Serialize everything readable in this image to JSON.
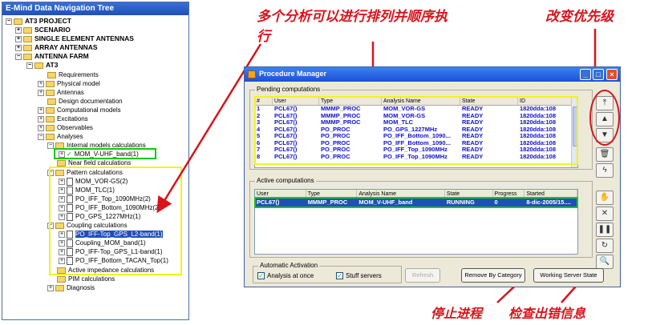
{
  "tree_window": {
    "title": "E-Mind Data Navigation Tree",
    "nodes": [
      {
        "label": "AT3 PROJECT"
      },
      {
        "label": "SCENARIO"
      },
      {
        "label": "SINGLE ELEMENT ANTENNAS"
      },
      {
        "label": "ARRAY ANTENNAS"
      },
      {
        "label": "ANTENNA FARM"
      },
      {
        "label": "AT3"
      },
      {
        "label": "Requirements"
      },
      {
        "label": "Physical model"
      },
      {
        "label": "Antennas"
      },
      {
        "label": "Design documentation"
      },
      {
        "label": "Computational models"
      },
      {
        "label": "Excitations"
      },
      {
        "label": "Observables"
      },
      {
        "label": "Analyses"
      },
      {
        "label": "Internal models calculations"
      },
      {
        "label": "MOM_V-UHF_band(1)"
      },
      {
        "label": "Near field calculations"
      },
      {
        "label": "Pattern calculations"
      },
      {
        "label": "MOM_VOR-GS(2)"
      },
      {
        "label": "MOM_TLC(1)"
      },
      {
        "label": "PO_IFF_Top_1090MHz(2)"
      },
      {
        "label": "PO_IFF_Bottom_1090MHz(2)"
      },
      {
        "label": "PO_GPS_1227MHz(1)"
      },
      {
        "label": "Coupling calculations"
      },
      {
        "label": "PO_IFF-Top_GPS_L2-band(1)"
      },
      {
        "label": "Coupling_MOM_band(1)"
      },
      {
        "label": "PO_IFF-Top_GPS_L1-band(1)"
      },
      {
        "label": "PO_IFF_Bottom_TACAN_Top(1)"
      },
      {
        "label": "Active impedance calculations"
      },
      {
        "label": "PIM calculations"
      },
      {
        "label": "Diagnosis"
      }
    ]
  },
  "annotations": {
    "sort_order_line1": "多个分析可以进行排列并顺序执",
    "sort_order_line2": "行",
    "change_priority": "改变优先级",
    "stop_process": "停止进程",
    "check_errors": "检查出错信息"
  },
  "procedure_manager": {
    "title": "Procedure Manager",
    "pending": {
      "label": "Pending computations",
      "columns": [
        "#",
        "User",
        "Type",
        "Analysis Name",
        "State",
        "ID"
      ],
      "rows": [
        [
          "1",
          "PCL67()",
          "MMMP_PROC",
          "MOM_VOR-GS",
          "READY",
          "1820dda:108"
        ],
        [
          "2",
          "PCL67()",
          "MMMP_PROC",
          "MOM_VOR-GS",
          "READY",
          "1820dda:108"
        ],
        [
          "3",
          "PCL67()",
          "MMMP_PROC",
          "MOM_TLC",
          "READY",
          "1820dda:108"
        ],
        [
          "4",
          "PCL67()",
          "PO_PROC",
          "PO_GPS_1227MHz",
          "READY",
          "1820dda:108"
        ],
        [
          "5",
          "PCL67()",
          "PO_PROC",
          "PO_IFF_Bottom_1090...",
          "READY",
          "1820dda:108"
        ],
        [
          "6",
          "PCL67()",
          "PO_PROC",
          "PO_IFF_Bottom_1090...",
          "READY",
          "1820dda:108"
        ],
        [
          "7",
          "PCL67()",
          "PO_PROC",
          "PO_IFF_Top_1090MHz",
          "READY",
          "1820dda:108"
        ],
        [
          "8",
          "PCL67()",
          "PO_PROC",
          "PO_IFF_Top_1090MHz",
          "READY",
          "1820dda:108"
        ]
      ]
    },
    "active": {
      "label": "Active computations",
      "columns": [
        "User",
        "Type",
        "Analysis Name",
        "State",
        "Progress",
        "Started"
      ],
      "rows": [
        [
          "PCL67()",
          "MMMP_PROC",
          "MOM_V-UHF_band",
          "RUNNING",
          "0",
          "8-dic-2005/15...."
        ]
      ]
    },
    "automatic_activation": {
      "label": "Automatic Activation",
      "analysis_at_once": "Analysis at once",
      "stuff_servers": "Stuff servers"
    },
    "buttons": {
      "refresh": "Refresh",
      "remove_by_category": "Remove By Category",
      "working_server_state": "Working Server State"
    }
  }
}
